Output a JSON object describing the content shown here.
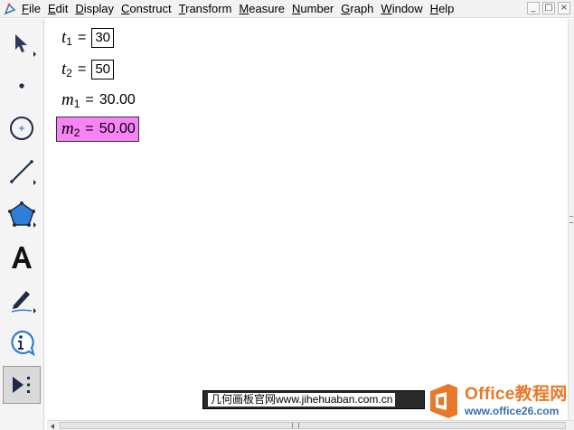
{
  "menubar": {
    "items": [
      {
        "mnemonic": "F",
        "rest": "ile"
      },
      {
        "mnemonic": "E",
        "rest": "dit"
      },
      {
        "mnemonic": "D",
        "rest": "isplay"
      },
      {
        "mnemonic": "C",
        "rest": "onstruct"
      },
      {
        "mnemonic": "T",
        "rest": "ransform"
      },
      {
        "mnemonic": "M",
        "rest": "easure"
      },
      {
        "mnemonic": "N",
        "rest": "umber"
      },
      {
        "mnemonic": "G",
        "rest": "raph"
      },
      {
        "mnemonic": "W",
        "rest": "indow"
      },
      {
        "mnemonic": "H",
        "rest": "elp"
      }
    ],
    "window_controls": [
      "_",
      "□",
      "×"
    ]
  },
  "toolbox": {
    "tools": [
      "arrow-select-tool",
      "point-tool",
      "compass-tool",
      "straightedge-tool",
      "polygon-tool",
      "text-tool",
      "marker-tool",
      "information-tool",
      "custom-tool"
    ]
  },
  "canvas": {
    "measurements": [
      {
        "var": "t",
        "sub": "1",
        "eq": "=",
        "value": "30"
      },
      {
        "var": "t",
        "sub": "2",
        "eq": "=",
        "value": "50"
      },
      {
        "var": "m",
        "sub": "1",
        "eq": "=",
        "value": "30.00"
      },
      {
        "var": "m",
        "sub": "2",
        "eq": "=",
        "value": "50.00"
      }
    ]
  },
  "watermarks": {
    "bar_text": "几何画板官网www.jihehuaban.com.cn",
    "logo_title": "Office教程网",
    "logo_url": "www.office26.com"
  },
  "colors": {
    "highlight": "#f783f7",
    "logo_orange": "#e8782a",
    "logo_blue": "#3a6fb0"
  }
}
